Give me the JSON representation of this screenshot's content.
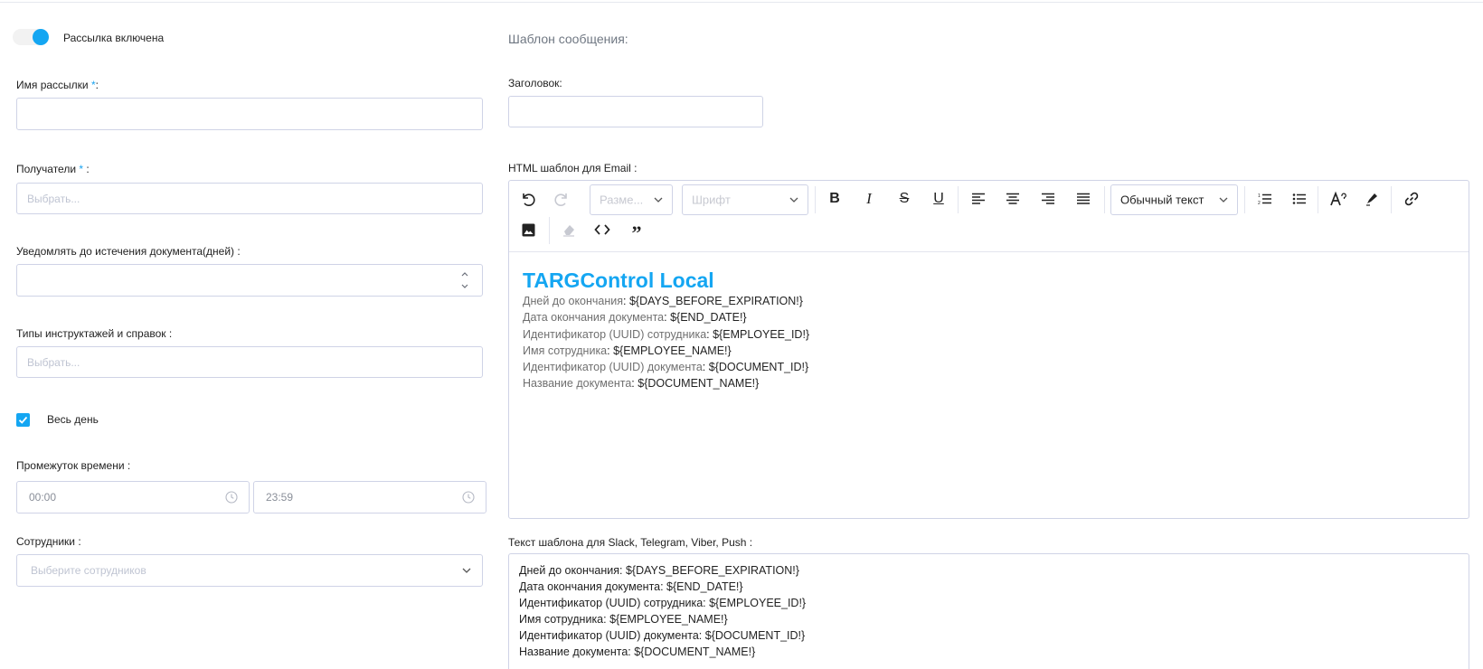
{
  "mailing_toggle": {
    "label": "Рассылка включена",
    "enabled": true
  },
  "name_field": {
    "label": "Имя рассылки",
    "required_mark": "*",
    "suffix": ":",
    "value": ""
  },
  "recipients": {
    "label": "Получатели",
    "required_mark": "*",
    "suffix": " :",
    "placeholder": "Выбрать..."
  },
  "notify_days": {
    "label": "Уведомлять до истечения документа(дней) :",
    "value": ""
  },
  "instruction_types": {
    "label": "Типы инструктажей и справок :",
    "placeholder": "Выбрать..."
  },
  "all_day": {
    "label": "Весь день",
    "checked": true
  },
  "time_range": {
    "label": "Промежуток времени :",
    "start": "00:00",
    "end": "23:59"
  },
  "employees": {
    "label": "Сотрудники :",
    "placeholder": "Выберите сотрудников"
  },
  "template": {
    "section_title": "Шаблон сообщения:",
    "subject_label": "Заголовок:",
    "subject_value": "",
    "html_label": "HTML шаблон для Email :",
    "toolbar": {
      "size_placeholder": "Разме...",
      "font_placeholder": "Шрифт",
      "block_format": "Обычный текст"
    },
    "html_content": {
      "heading": "TARGControl Local",
      "lines": [
        {
          "key": "Дней до окончания",
          "value": "${DAYS_BEFORE_EXPIRATION!}"
        },
        {
          "key": "Дата окончания документа",
          "value": "${END_DATE!}"
        },
        {
          "key": "Идентификатор (UUID) сотрудника",
          "value": "${EMPLOYEE_ID!}"
        },
        {
          "key": "Имя сотрудника",
          "value": "${EMPLOYEE_NAME!}"
        },
        {
          "key": "Идентификатор (UUID) документа",
          "value": "${DOCUMENT_ID!}"
        },
        {
          "key": "Название документа",
          "value": "${DOCUMENT_NAME!}"
        }
      ]
    },
    "text_label": "Текст шаблона для Slack, Telegram, Viber, Push :",
    "text_lines": [
      "Дней до окончания: ${DAYS_BEFORE_EXPIRATION!}",
      "Дата окончания документа: ${END_DATE!}",
      "Идентификатор (UUID) сотрудника: ${EMPLOYEE_ID!}",
      "Имя сотрудника: ${EMPLOYEE_NAME!}",
      "Идентификатор (UUID) документа: ${DOCUMENT_ID!}",
      "Название документа: ${DOCUMENT_NAME!}"
    ]
  },
  "colors": {
    "accent": "#14a6f2",
    "border": "#cfd3e6",
    "placeholder": "#bfc4d2"
  }
}
